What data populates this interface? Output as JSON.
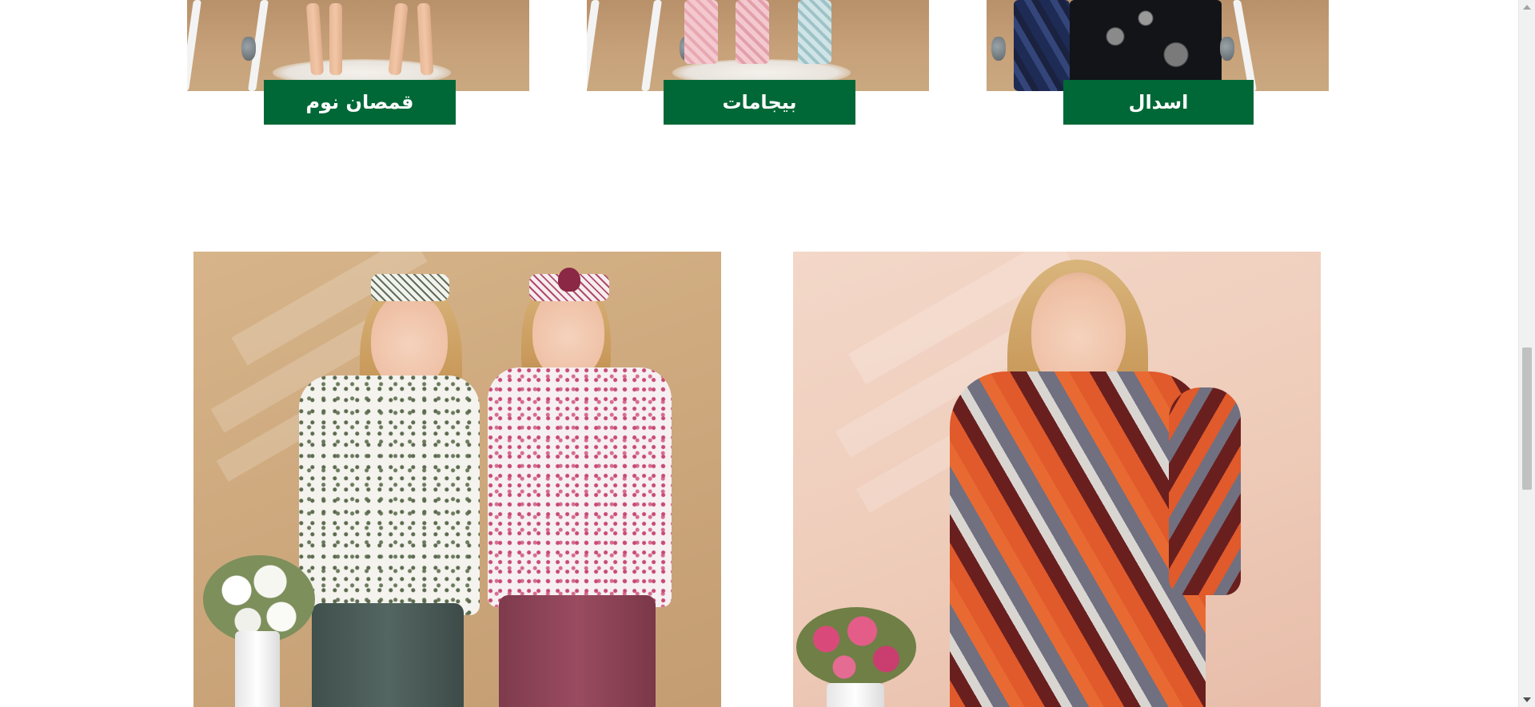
{
  "categories": [
    {
      "label": "قمصان نوم",
      "image": "nightgowns-photo"
    },
    {
      "label": "بيجامات",
      "image": "pajamas-photo"
    },
    {
      "label": "اسدال",
      "image": "prayer-dress-photo"
    }
  ],
  "colors": {
    "category_button_bg": "#006837",
    "category_button_text": "#ffffff",
    "page_bg": "#ffffff"
  },
  "featured": [
    {
      "image": "two-models-floral-pajama-tops-photo"
    },
    {
      "image": "model-patterned-shirt-nightwear-photo"
    }
  ]
}
